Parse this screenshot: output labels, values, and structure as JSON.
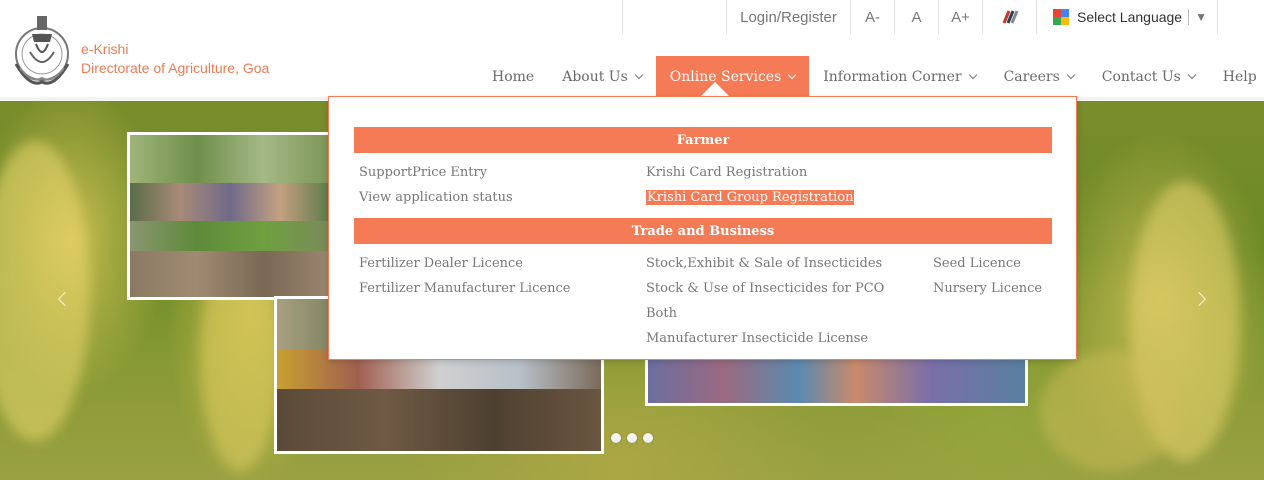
{
  "topbar": {
    "login_label": "Login/Register",
    "font_decrease": "A-",
    "font_normal": "A",
    "font_increase": "A+",
    "language_label": "Select Language",
    "language_arrow": "▼"
  },
  "brand": {
    "line1": "e-Krishi",
    "line2": "Directorate of Agriculture, Goa"
  },
  "nav": {
    "items": [
      {
        "label": "Home",
        "has_dropdown": false
      },
      {
        "label": "About Us",
        "has_dropdown": true
      },
      {
        "label": "Online Services",
        "has_dropdown": true,
        "active": true
      },
      {
        "label": "Information Corner",
        "has_dropdown": true
      },
      {
        "label": "Careers",
        "has_dropdown": true
      },
      {
        "label": "Contact Us",
        "has_dropdown": true
      },
      {
        "label": "Help",
        "has_dropdown": false
      }
    ]
  },
  "dropdown": {
    "farmer": {
      "heading": "Farmer",
      "links": [
        "SupportPrice Entry",
        "View application status",
        "Krishi Card Registration",
        "Krishi Card Group Registration"
      ]
    },
    "trade": {
      "heading": "Trade and Business",
      "links": [
        "Fertilizer Dealer Licence",
        "Fertilizer Manufacturer Licence",
        "Stock,Exhibit & Sale of Insecticides",
        "Stock & Use of Insecticides for PCO",
        "Both",
        "Manufacturer Insecticide License",
        "Seed Licence",
        "Nursery Licence"
      ]
    }
  },
  "colors": {
    "accent": "#f47b55",
    "brand_text": "#f07a52",
    "nav_text": "#6a6a6a"
  },
  "slider": {
    "dot_count": 3
  }
}
